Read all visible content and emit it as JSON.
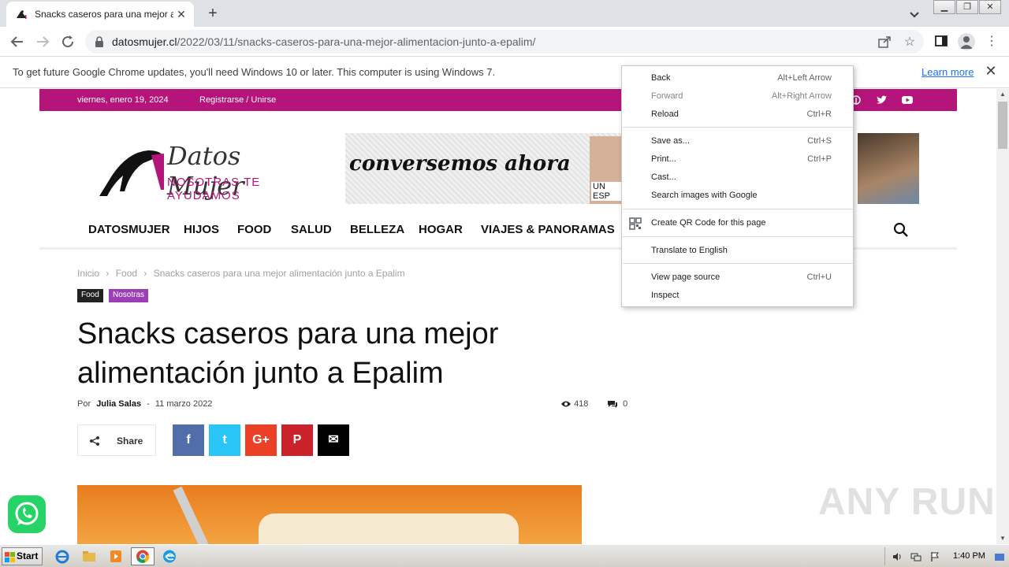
{
  "browser": {
    "tab_title": "Snacks caseros para una mejor alime",
    "new_tab_symbol": "+",
    "url_host": "datosmujer.cl",
    "url_path": "/2022/03/11/snacks-caseros-para-una-mejor-alimentacion-junto-a-epalim/",
    "infobar_message": "To get future Google Chrome updates, you'll need Windows 10 or later. This computer is using Windows 7.",
    "infobar_link": "Learn more"
  },
  "site": {
    "date": "viernes, enero 19, 2024",
    "register": "Registrarse / Unirse",
    "logo_line1": "Datos Mujer",
    "logo_line2": "NOSOTRAS TE AYUDAMOS",
    "banner_text": "conversemos ahora",
    "banner_tag": "UN ESP",
    "nav": [
      "DATOSMUJER",
      "HIJOS",
      "FOOD",
      "SALUD",
      "BELLEZA",
      "HOGAR",
      "VIAJES & PANORAMAS"
    ],
    "breadcrumb": [
      "Inicio",
      "Food",
      "Snacks caseros para una mejor alimentación junto a Epalim"
    ],
    "breadcrumb_sep": "›",
    "categories": [
      {
        "label": "Food",
        "color": "#222222"
      },
      {
        "label": "Nosotras",
        "color": "#9c3fb6"
      }
    ],
    "headline": "Snacks caseros para una mejor alimentación junto a Epalim",
    "author_prefix": "Por",
    "author": "Julia Salas",
    "date_sep": "-",
    "post_date": "11 marzo 2022",
    "views": "418",
    "comments": "0",
    "share_label": "Share",
    "share_buttons": [
      {
        "name": "facebook",
        "glyph": "f",
        "color": "#516eab"
      },
      {
        "name": "twitter",
        "glyph": "t",
        "color": "#29c5f6"
      },
      {
        "name": "googleplus",
        "glyph": "G+",
        "color": "#eb4026"
      },
      {
        "name": "pinterest",
        "glyph": "P",
        "color": "#ca212a"
      },
      {
        "name": "email",
        "glyph": "✉",
        "color": "#000000"
      }
    ],
    "brand_color": "#b5157a"
  },
  "context_menu": {
    "items": [
      {
        "label": "Back",
        "shortcut": "Alt+Left Arrow",
        "enabled": true
      },
      {
        "label": "Forward",
        "shortcut": "Alt+Right Arrow",
        "enabled": false
      },
      {
        "label": "Reload",
        "shortcut": "Ctrl+R",
        "enabled": true
      },
      {
        "label": "Save as...",
        "shortcut": "Ctrl+S",
        "enabled": true
      },
      {
        "label": "Print...",
        "shortcut": "Ctrl+P",
        "enabled": true
      },
      {
        "label": "Cast...",
        "shortcut": "",
        "enabled": true
      },
      {
        "label": "Search images with Google",
        "shortcut": "",
        "enabled": true
      },
      {
        "label": "Create QR Code for this page",
        "shortcut": "",
        "enabled": true
      },
      {
        "label": "Translate to English",
        "shortcut": "",
        "enabled": true
      },
      {
        "label": "View page source",
        "shortcut": "Ctrl+U",
        "enabled": true
      },
      {
        "label": "Inspect",
        "shortcut": "",
        "enabled": true
      }
    ]
  },
  "taskbar": {
    "start_label": "Start",
    "clock": "1:40 PM"
  },
  "watermark": "ANY RUN"
}
